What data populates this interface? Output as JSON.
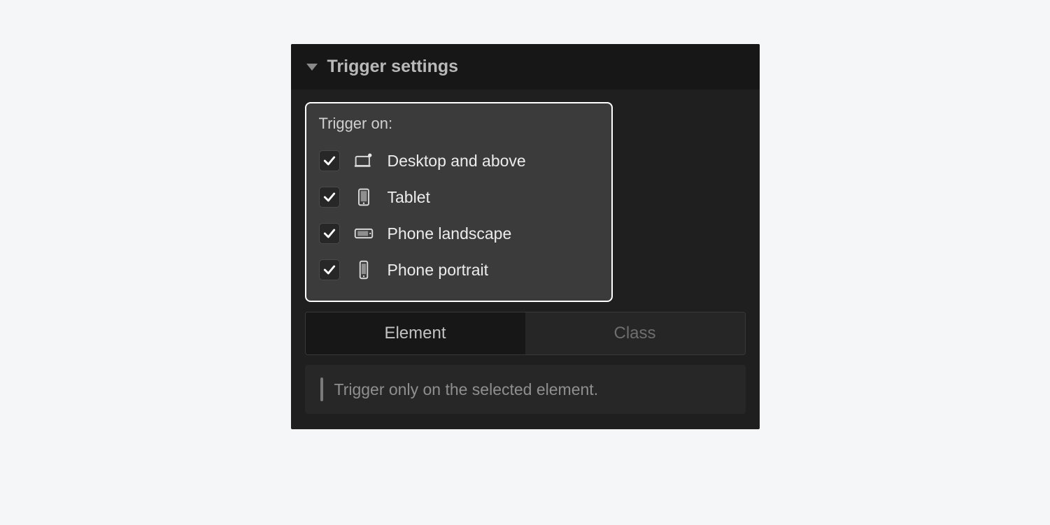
{
  "panel": {
    "title": "Trigger settings"
  },
  "trigger": {
    "label": "Trigger on:",
    "options": [
      {
        "label": "Desktop and above",
        "checked": true,
        "icon": "desktop"
      },
      {
        "label": "Tablet",
        "checked": true,
        "icon": "tablet"
      },
      {
        "label": "Phone landscape",
        "checked": true,
        "icon": "phone-landscape"
      },
      {
        "label": "Phone portrait",
        "checked": true,
        "icon": "phone-portrait"
      }
    ]
  },
  "tabs": {
    "element": "Element",
    "class": "Class",
    "active": "element"
  },
  "help": {
    "text": "Trigger only on the selected element."
  }
}
